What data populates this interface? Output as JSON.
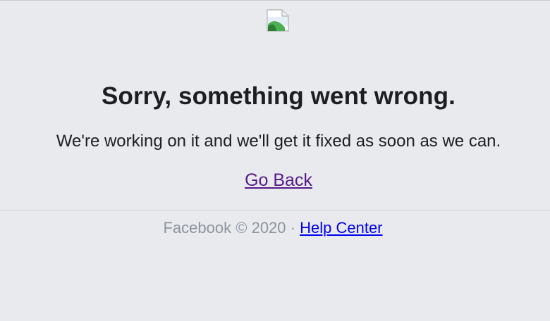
{
  "logo": {
    "icon": "broken-image-icon"
  },
  "error": {
    "title": "Sorry, something went wrong.",
    "message": "We're working on it and we'll get it fixed as soon as we can.",
    "go_back_label": "Go Back"
  },
  "footer": {
    "brand": "Facebook",
    "copyright_symbol": "©",
    "year": "2020",
    "separator": "·",
    "help_center_label": "Help Center"
  },
  "colors": {
    "background": "#e9eaee",
    "text": "#1c1e21",
    "visited_link": "#551a8b",
    "link": "#0000ee",
    "muted": "#8d949e"
  }
}
